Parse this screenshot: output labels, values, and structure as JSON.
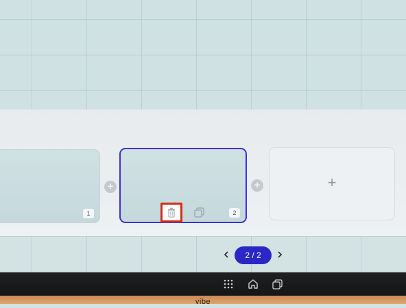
{
  "pages": [
    {
      "number": "1",
      "selected": false
    },
    {
      "number": "2",
      "selected": true
    }
  ],
  "add_page_label": "+",
  "insert_label": "+",
  "pagination": {
    "indicator": "2 / 2"
  },
  "device": {
    "brand": "vibe"
  },
  "colors": {
    "accent": "#2a27c4",
    "selected_border": "#3a33cf",
    "highlight_box": "#d42d16"
  },
  "icons": {
    "delete": "trash-icon",
    "duplicate": "duplicate-icon",
    "prev": "chevron-left-icon",
    "next": "chevron-right-icon",
    "apps": "apps-grid-icon",
    "home": "home-icon",
    "recents": "recent-apps-icon"
  }
}
